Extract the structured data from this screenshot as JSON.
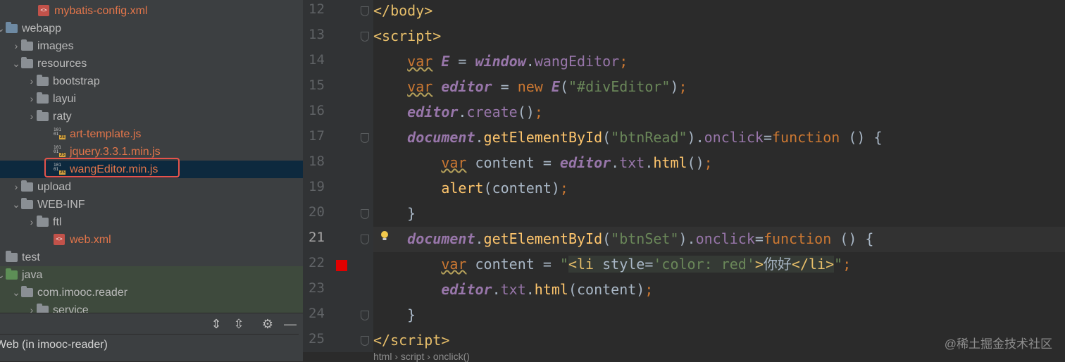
{
  "project_tree": {
    "items": [
      {
        "label": "mybatis-config.xml",
        "icon": "xml-file-icon",
        "arrow": "",
        "orange": true
      },
      {
        "label": "webapp",
        "icon": "web-folder-icon",
        "arrow": "open",
        "orange": false
      },
      {
        "label": "images",
        "icon": "folder-icon",
        "arrow": "closed",
        "orange": false
      },
      {
        "label": "resources",
        "icon": "folder-icon",
        "arrow": "open",
        "orange": false
      },
      {
        "label": "bootstrap",
        "icon": "folder-icon",
        "arrow": "closed",
        "orange": false
      },
      {
        "label": "layui",
        "icon": "folder-icon",
        "arrow": "closed",
        "orange": false
      },
      {
        "label": "raty",
        "icon": "folder-icon",
        "arrow": "closed",
        "orange": false
      },
      {
        "label": "art-template.js",
        "icon": "js-file-icon",
        "arrow": "",
        "orange": true
      },
      {
        "label": "jquery.3.3.1.min.js",
        "icon": "js-file-icon",
        "arrow": "",
        "orange": true
      },
      {
        "label": "wangEditor.min.js",
        "icon": "js-file-icon",
        "arrow": "",
        "orange": true,
        "selected": true
      },
      {
        "label": "upload",
        "icon": "folder-icon",
        "arrow": "closed",
        "orange": false
      },
      {
        "label": "WEB-INF",
        "icon": "folder-icon",
        "arrow": "open",
        "orange": false
      },
      {
        "label": "ftl",
        "icon": "folder-icon",
        "arrow": "closed",
        "orange": false
      },
      {
        "label": "web.xml",
        "icon": "xml-file-icon",
        "arrow": "",
        "orange": true
      },
      {
        "label": "test",
        "icon": "folder-icon",
        "arrow": "",
        "orange": false
      },
      {
        "label": "java",
        "icon": "test-source-folder-icon",
        "arrow": "open",
        "orange": false
      },
      {
        "label": "com.imooc.reader",
        "icon": "package-icon",
        "arrow": "open",
        "orange": false
      },
      {
        "label": "service",
        "icon": "package-icon",
        "arrow": "closed",
        "orange": false
      }
    ]
  },
  "toolbar": {
    "icons": [
      "expand-all-icon",
      "collapse-all-icon",
      "gear-icon",
      "minimize-icon"
    ]
  },
  "status": {
    "text": "Web (in imooc-reader)"
  },
  "editor": {
    "line_numbers": [
      "12",
      "13",
      "14",
      "15",
      "16",
      "17",
      "18",
      "19",
      "20",
      "21",
      "22",
      "23",
      "24",
      "25"
    ],
    "active_line": "21"
  },
  "breadcrumb": {
    "items": [
      "html",
      "script",
      "onclick()"
    ]
  },
  "watermark": {
    "text": "@稀土掘金技术社区"
  },
  "colors": {
    "selection": "#0d293e",
    "highlight_box": "#e5534b",
    "breakpoint": "#e00000"
  }
}
